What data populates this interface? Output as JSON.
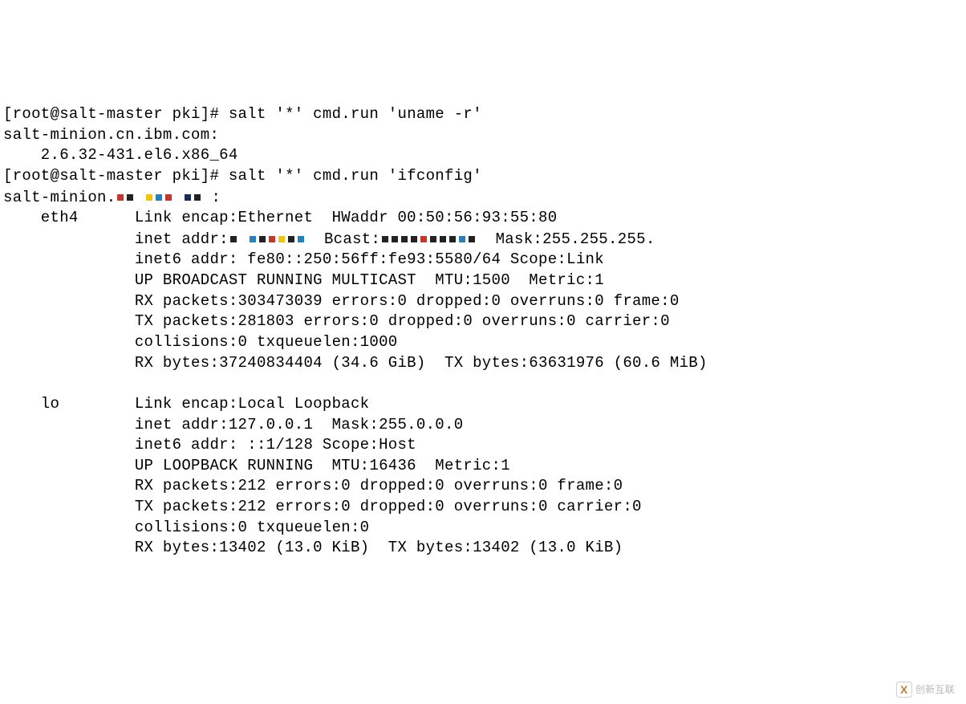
{
  "prompt1": "[root@salt-master pki]# ",
  "cmd1": "salt '*' cmd.run 'uname -r'",
  "minion1_host": "salt-minion.cn.ibm.com:",
  "kernel_version": "    2.6.32-431.el6.x86_64",
  "prompt2": "[root@salt-master pki]# ",
  "cmd2": "salt '*' cmd.run 'ifconfig'",
  "minion2_prefix": "salt-minion.",
  "minion2_suffix": ":",
  "eth4": {
    "iface": "    eth4      ",
    "link": "Link encap:Ethernet  HWaddr 00:50:56:93:55:80",
    "indent": "              ",
    "inet_prefix": "inet addr:",
    "inet_bcast_prefix": "  Bcast:",
    "inet_mask": "  Mask:255.255.255.",
    "inet6": "inet6 addr: fe80::250:56ff:fe93:5580/64 Scope:Link",
    "upline": "UP BROADCAST RUNNING MULTICAST  MTU:1500  Metric:1",
    "rxpackets": "RX packets:303473039 errors:0 dropped:0 overruns:0 frame:0",
    "txpackets": "TX packets:281803 errors:0 dropped:0 overruns:0 carrier:0",
    "collisions": "collisions:0 txqueuelen:1000",
    "bytes": "RX bytes:37240834404 (34.6 GiB)  TX bytes:63631976 (60.6 MiB)"
  },
  "lo": {
    "iface": "    lo        ",
    "link": "Link encap:Local Loopback",
    "indent": "              ",
    "inet": "inet addr:127.0.0.1  Mask:255.0.0.0",
    "inet6": "inet6 addr: ::1/128 Scope:Host",
    "upline": "UP LOOPBACK RUNNING  MTU:16436  Metric:1",
    "rxpackets": "RX packets:212 errors:0 dropped:0 overruns:0 frame:0",
    "txpackets": "TX packets:212 errors:0 dropped:0 overruns:0 carrier:0",
    "collisions": "collisions:0 txqueuelen:0",
    "bytes": "RX bytes:13402 (13.0 KiB)  TX bytes:13402 (13.0 KiB)"
  },
  "watermark": {
    "icon": "X",
    "text": "创新互联"
  }
}
